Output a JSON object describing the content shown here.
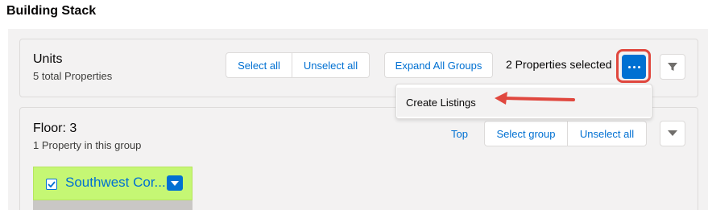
{
  "page": {
    "title": "Building Stack"
  },
  "units": {
    "heading": "Units",
    "subtext": "5 total Properties",
    "select_all_label": "Select all",
    "unselect_all_label": "Unselect all",
    "expand_label": "Expand All Groups",
    "selected_text": "2 Properties selected",
    "more_icon": "ellipsis-icon",
    "filter_icon": "filter-icon"
  },
  "menu": {
    "items": [
      {
        "label": "Create Listings"
      }
    ]
  },
  "floor": {
    "heading": "Floor: 3",
    "subtext": "1 Property in this group",
    "top_label": "Top",
    "select_group_label": "Select group",
    "unselect_all_label": "Unselect all",
    "toggle_icon": "chevron-down-icon"
  },
  "unit_tile": {
    "title": "Southwest Cor...",
    "checked": true,
    "color": "#c5f774"
  },
  "colors": {
    "brand": "#0070d2",
    "highlight": "#e0473e"
  }
}
